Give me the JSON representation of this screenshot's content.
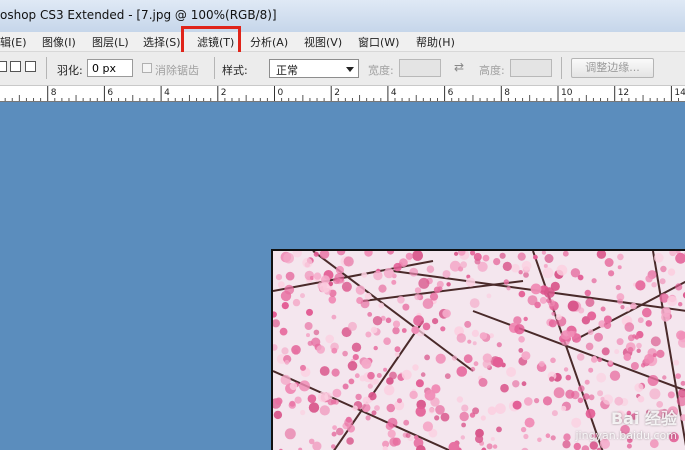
{
  "window": {
    "title": "oshop CS3 Extended - [7.jpg @ 100%(RGB/8)]"
  },
  "menu": {
    "items": [
      {
        "label": "辑(E)"
      },
      {
        "label": "图像(I)"
      },
      {
        "label": "图层(L)"
      },
      {
        "label": "选择(S)"
      },
      {
        "label": "滤镜(T)"
      },
      {
        "label": "分析(A)"
      },
      {
        "label": "视图(V)"
      },
      {
        "label": "窗口(W)"
      },
      {
        "label": "帮助(H)"
      }
    ]
  },
  "options": {
    "feather_label": "羽化:",
    "feather_value": "0 px",
    "antialias_label": "消除锯齿",
    "style_label": "样式:",
    "style_value": "正常",
    "width_label": "宽度:",
    "height_label": "高度:",
    "refine_edge_label": "调整边缘..."
  },
  "ruler": {
    "ticks": [
      "0",
      "8",
      "6",
      "4",
      "2",
      "0",
      "2",
      "4",
      "6",
      "8",
      "10",
      "12",
      "14"
    ]
  },
  "watermark": {
    "brand": "Bai 经验",
    "url": "jingyan.baidu.com"
  },
  "colors": {
    "canvas_bg": "#5b8dbd",
    "highlight": "#e0241a"
  }
}
